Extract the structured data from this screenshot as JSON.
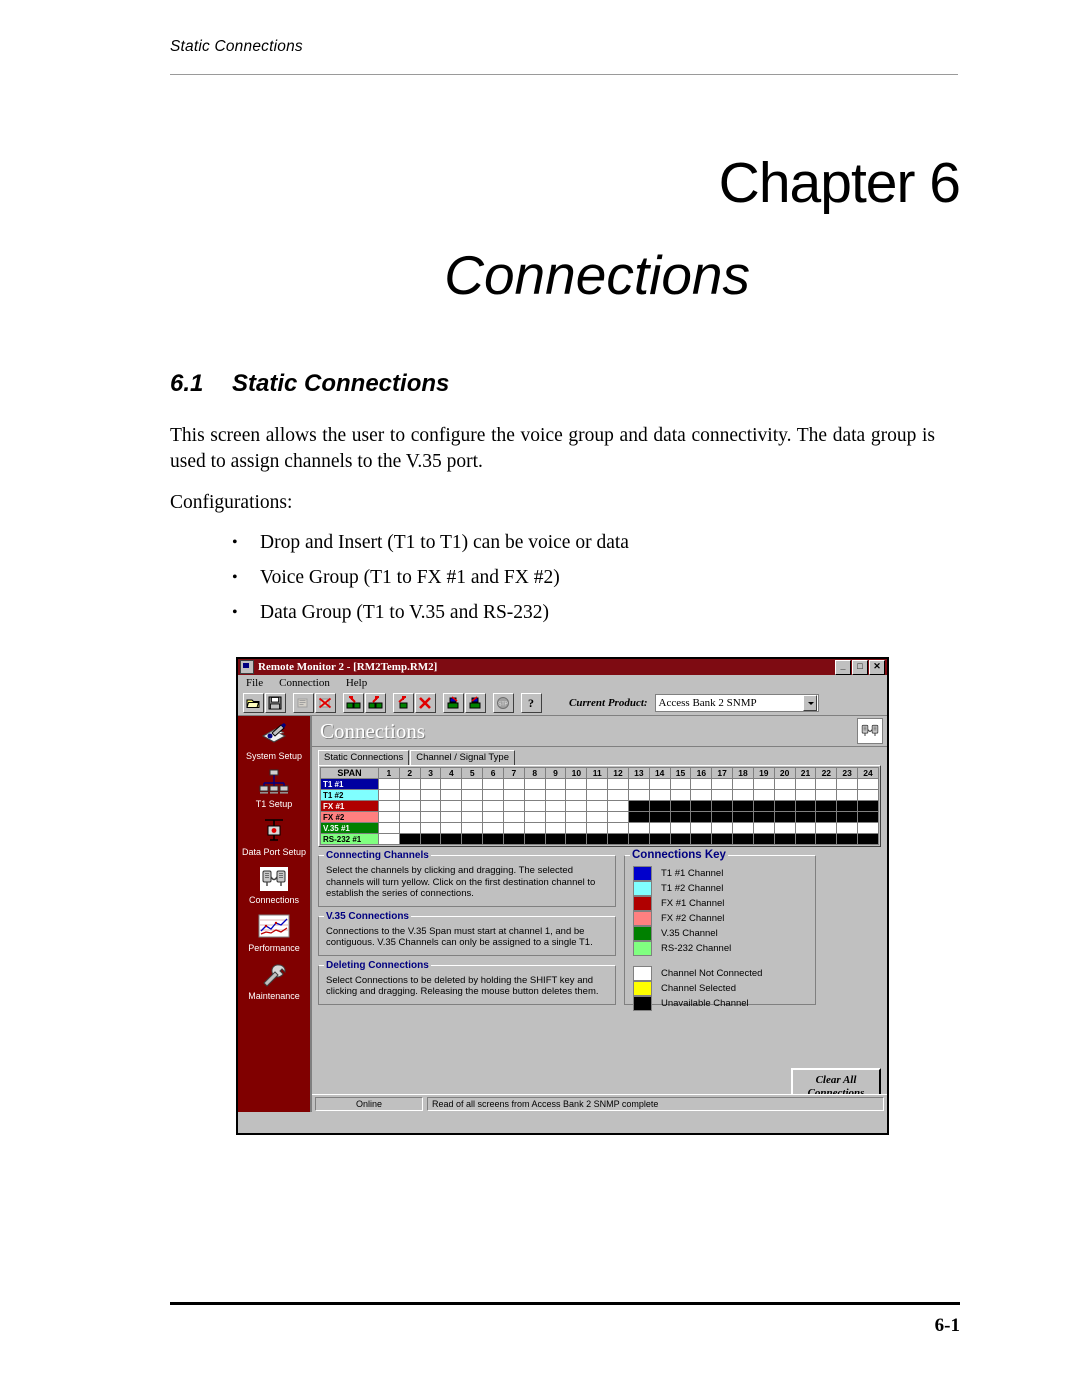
{
  "page": {
    "running_head": "Static Connections",
    "chapter_number": "Chapter 6",
    "chapter_name": "Connections",
    "section_number": "6.1",
    "section_title": "Static Connections",
    "paragraph_1": "This screen allows the user to configure the voice  group and data connectivity. The data group is used to assign channels to the V.35 port.",
    "paragraph_2": "Configurations:",
    "bullet_char": "•",
    "bullets": [
      "Drop and Insert (T1 to T1) can be voice or data",
      "Voice Group (T1 to FX #1 and FX #2)",
      "Data Group (T1 to V.35 and RS-232)"
    ],
    "footer_page": "6-1"
  },
  "app": {
    "title": "Remote Monitor 2 - [RM2Temp.RM2]",
    "title_icon": "application-icon",
    "window_buttons": [
      {
        "name": "minimize-button",
        "glyph": "_"
      },
      {
        "name": "maximize-button",
        "glyph": "□"
      },
      {
        "name": "close-button",
        "glyph": "✕"
      }
    ],
    "menus": [
      {
        "label": "File",
        "accel": "F"
      },
      {
        "label": "Connection",
        "accel": "C"
      },
      {
        "label": "Help",
        "accel": "H"
      }
    ],
    "toolbar": {
      "buttons": [
        {
          "name": "open-file-icon",
          "title": "Open"
        },
        {
          "name": "save-file-icon",
          "title": "Save"
        },
        {
          "name": "print-icon",
          "title": "Print"
        },
        {
          "name": "print-cancel-icon",
          "title": "Cancel Print"
        },
        {
          "name": "connect-upload-icon",
          "title": "Upload"
        },
        {
          "name": "connect-download-icon",
          "title": "Download"
        },
        {
          "name": "device-read-icon",
          "title": "Read"
        },
        {
          "name": "device-delete-icon",
          "title": "Delete"
        },
        {
          "name": "device-send-icon",
          "title": "Send"
        },
        {
          "name": "device-receive-icon",
          "title": "Receive"
        },
        {
          "name": "stop-icon",
          "title": "Stop"
        },
        {
          "name": "help-icon",
          "title": "Help"
        }
      ],
      "current_product_label": "Current Product:",
      "current_product_value": "Access Bank 2 SNMP"
    },
    "sidebar": [
      {
        "label": "System Setup",
        "icon": "system-setup-icon"
      },
      {
        "label": "T1 Setup",
        "icon": "t1-setup-icon"
      },
      {
        "label": "Data Port Setup",
        "icon": "data-port-setup-icon"
      },
      {
        "label": "Connections",
        "icon": "connections-icon"
      },
      {
        "label": "Performance",
        "icon": "performance-chart-icon"
      },
      {
        "label": "Maintenance",
        "icon": "wrench-icon"
      }
    ],
    "page_title": "Connections",
    "page_title_icon": "connections-icon",
    "tabs": [
      {
        "label": "Static Connections",
        "active": true
      },
      {
        "label": "Channel / Signal Type",
        "active": false
      }
    ],
    "grid": {
      "span_header": "SPAN",
      "columns": [
        "1",
        "2",
        "3",
        "4",
        "5",
        "6",
        "7",
        "8",
        "9",
        "10",
        "11",
        "12",
        "13",
        "14",
        "15",
        "16",
        "17",
        "18",
        "19",
        "20",
        "21",
        "22",
        "23",
        "24"
      ],
      "rows": [
        {
          "label": "T1 #1",
          "bg": "#0000a0",
          "fg": "#ffffff",
          "cells": [
            "w",
            "w",
            "w",
            "w",
            "w",
            "w",
            "w",
            "w",
            "w",
            "w",
            "w",
            "w",
            "w",
            "w",
            "w",
            "w",
            "w",
            "w",
            "w",
            "w",
            "w",
            "w",
            "w",
            "w"
          ]
        },
        {
          "label": "T1 #2",
          "bg": "#80ffff",
          "fg": "#000000",
          "cells": [
            "w",
            "w",
            "w",
            "w",
            "w",
            "w",
            "w",
            "w",
            "w",
            "w",
            "w",
            "w",
            "w",
            "w",
            "w",
            "w",
            "w",
            "w",
            "w",
            "w",
            "w",
            "w",
            "w",
            "w"
          ]
        },
        {
          "label": "FX #1",
          "bg": "#b00000",
          "fg": "#ffffff",
          "cells": [
            "w",
            "w",
            "w",
            "w",
            "w",
            "w",
            "w",
            "w",
            "w",
            "w",
            "w",
            "w",
            "k",
            "k",
            "k",
            "k",
            "k",
            "k",
            "k",
            "k",
            "k",
            "k",
            "k",
            "k"
          ]
        },
        {
          "label": "FX #2",
          "bg": "#ff8080",
          "fg": "#000000",
          "cells": [
            "w",
            "w",
            "w",
            "w",
            "w",
            "w",
            "w",
            "w",
            "w",
            "w",
            "w",
            "w",
            "k",
            "k",
            "k",
            "k",
            "k",
            "k",
            "k",
            "k",
            "k",
            "k",
            "k",
            "k"
          ]
        },
        {
          "label": "V.35 #1",
          "bg": "#008000",
          "fg": "#ffffff",
          "cells": [
            "w",
            "w",
            "w",
            "w",
            "w",
            "w",
            "w",
            "w",
            "w",
            "w",
            "w",
            "w",
            "w",
            "w",
            "w",
            "w",
            "w",
            "w",
            "w",
            "w",
            "w",
            "w",
            "w",
            "w"
          ]
        },
        {
          "label": "RS-232 #1",
          "bg": "#80ff80",
          "fg": "#000000",
          "cells": [
            "w",
            "k",
            "k",
            "k",
            "k",
            "k",
            "k",
            "k",
            "k",
            "k",
            "k",
            "k",
            "k",
            "k",
            "k",
            "k",
            "k",
            "k",
            "k",
            "k",
            "k",
            "k",
            "k",
            "k"
          ]
        }
      ]
    },
    "info_boxes": [
      {
        "title": "Connecting Channels",
        "text": "Select the channels by clicking and dragging. The selected channels will turn yellow. Click on the first destination channel to establish the series of connections."
      },
      {
        "title": "V.35 Connections",
        "text": "Connections to the V.35 Span must start at channel 1, and be contiguous. V.35 Channels can only be assigned to a single T1."
      },
      {
        "title": "Deleting Connections",
        "text": "Select Connections to be deleted by holding the SHIFT key and clicking and dragging. Releasing the mouse button deletes them."
      }
    ],
    "key": {
      "title": "Connections Key",
      "entries": [
        {
          "label": "T1 #1 Channel",
          "color": "#0000cc"
        },
        {
          "label": "T1 #2 Channel",
          "color": "#80ffff"
        },
        {
          "label": "FX #1 Channel",
          "color": "#b00000"
        },
        {
          "label": "FX #2 Channel",
          "color": "#ff8080"
        },
        {
          "label": "V.35 Channel",
          "color": "#008000"
        },
        {
          "label": "RS-232 Channel",
          "color": "#80ff80"
        }
      ],
      "states": [
        {
          "label": "Channel Not Connected",
          "color": "#ffffff"
        },
        {
          "label": "Channel Selected",
          "color": "#ffff00"
        },
        {
          "label": "Unavailable Channel",
          "color": "#000000"
        }
      ]
    },
    "clear_button": {
      "line1": "Clear All",
      "line2": "Connections"
    },
    "status": {
      "connection_state": "Online",
      "message": "Read of all screens from Access Bank 2 SNMP complete"
    },
    "colors": {
      "title_bar": "#7e0b12",
      "sidebar": "#800000",
      "face": "#c0c0c0",
      "group_title": "#000080"
    }
  }
}
